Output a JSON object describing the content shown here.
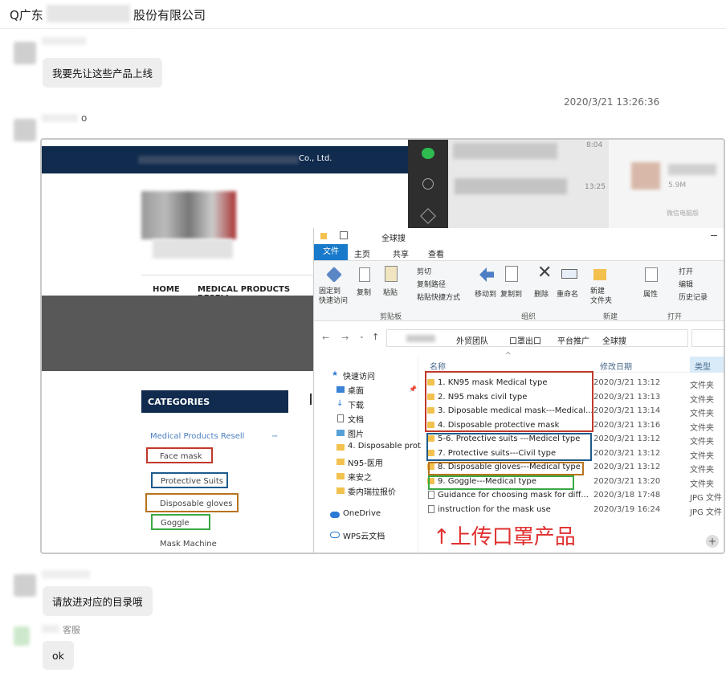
{
  "chat": {
    "title_prefix": "Q广东",
    "title_suffix": "股份有限公司",
    "messages": [
      {
        "text": "我要先让这些产品上线"
      },
      {
        "text": "请放进对应的目录哦"
      },
      {
        "text": "ok"
      }
    ],
    "timestamp": "2020/3/21 13:26:36",
    "small_dot": "o",
    "agent_label": "客服"
  },
  "screenshot": {
    "website": {
      "company": "Co., Ltd.",
      "nav": [
        "HOME",
        "MEDICAL PRODUCTS RESELL"
      ],
      "categories_title": "CATEGORIES",
      "categories_toggle": "−",
      "categories_parent": "Medical Products Resell",
      "categories": [
        "Face mask",
        "Protective Suits",
        "Disposable gloves",
        "Goggle",
        "Mask Machine"
      ]
    },
    "wechat": {
      "time1": "8:04",
      "time2": "13:25",
      "file_size": "5.9M",
      "pc_label": "微信电脑版"
    },
    "explorer": {
      "window_title": "全球搜",
      "tabs": [
        "文件",
        "主页",
        "共享",
        "查看"
      ],
      "ribbon": {
        "pin": "固定到\n快速访问",
        "copy": "复制",
        "paste": "粘贴",
        "cut": "剪切",
        "copy_path": "复制路径",
        "paste_shortcut": "粘贴快捷方式",
        "move_to": "移动到",
        "copy_to": "复制到",
        "delete": "删除",
        "rename": "重命名",
        "new_folder": "新建\n文件夹",
        "properties": "属性",
        "open": "打开",
        "edit": "编辑",
        "history": "历史记录",
        "groups": [
          "剪贴板",
          "组织",
          "新建",
          "打开"
        ]
      },
      "breadcrumb": [
        "外贸团队",
        "口罩出口",
        "平台推广",
        "全球搜"
      ],
      "columns": [
        "名称",
        "修改日期",
        "类型"
      ],
      "sidebar": [
        {
          "label": "快速访问"
        },
        {
          "label": "桌面"
        },
        {
          "label": "下载"
        },
        {
          "label": "文档"
        },
        {
          "label": "图片"
        },
        {
          "label": "4. Disposable prot"
        },
        {
          "label": "N95-医用"
        },
        {
          "label": "来安之"
        },
        {
          "label": "委内瑞拉报价"
        },
        {
          "label": "OneDrive"
        },
        {
          "label": "WPS云文档"
        }
      ],
      "files": [
        {
          "name": "1. KN95 mask Medical type",
          "date": "2020/3/21 13:12",
          "type": "文件夹",
          "kind": "folder"
        },
        {
          "name": "2. N95 maks civil type",
          "date": "2020/3/21 13:13",
          "type": "文件夹",
          "kind": "folder"
        },
        {
          "name": "3. Diposable medical mask---Medical...",
          "date": "2020/3/21 13:14",
          "type": "文件夹",
          "kind": "folder"
        },
        {
          "name": "4. Disposable protective mask",
          "date": "2020/3/21 13:16",
          "type": "文件夹",
          "kind": "folder"
        },
        {
          "name": "5-6. Protective suits ---Medicel type",
          "date": "2020/3/21 13:12",
          "type": "文件夹",
          "kind": "folder"
        },
        {
          "name": "7. Protective suits---Civil type",
          "date": "2020/3/21 13:12",
          "type": "文件夹",
          "kind": "folder"
        },
        {
          "name": "8. Disposable gloves---Medical type",
          "date": "2020/3/21 13:12",
          "type": "文件夹",
          "kind": "folder"
        },
        {
          "name": "9. Goggle---Medical type",
          "date": "2020/3/21 13:20",
          "type": "文件夹",
          "kind": "folder"
        },
        {
          "name": "Guidance for choosing  mask for diff...",
          "date": "2020/3/18 17:48",
          "type": "JPG 文件",
          "kind": "jpg"
        },
        {
          "name": "instruction for the mask use",
          "date": "2020/3/19 16:24",
          "type": "JPG 文件",
          "kind": "jpg"
        }
      ],
      "annotation": "↑上传口罩产品"
    }
  },
  "colors": {
    "red": "#c0392b",
    "blue": "#1f5a8c",
    "orange": "#b8731e",
    "green": "#3aa843",
    "annot": "#e03030"
  }
}
